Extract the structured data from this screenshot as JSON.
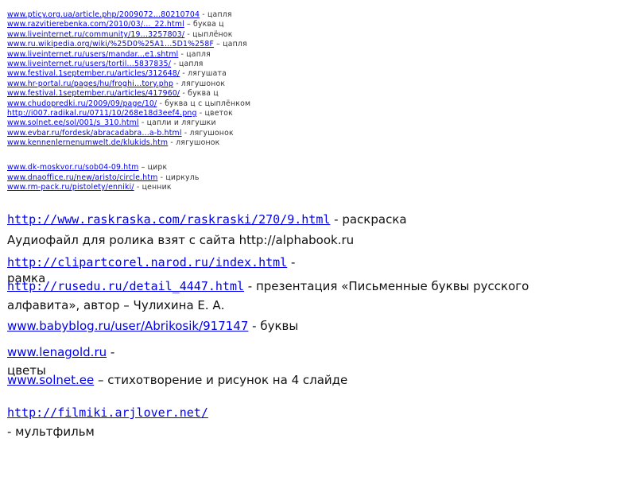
{
  "small_links_group1": [
    {
      "url": "www.pticy.org.ua/article.php/2009072...80210704",
      "desc": " - цапля"
    },
    {
      "url": "www.razvitierebenka.com/2010/03/..._22.html",
      "desc": " – буква ц"
    },
    {
      "url": "www.liveinternet.ru/community/19...3257803/",
      "desc": " - цыплёнок"
    },
    {
      "url": "www.ru.wikipedia.org/wiki/%25D0%25A1...5D1%258F",
      "desc": " – цапля"
    },
    {
      "url": "www.liveinternet.ru/users/mandar...e1.shtml",
      "desc": " - цапля"
    },
    {
      "url": "www.liveinternet.ru/users/tortil...5837835/",
      "desc": " - цапля"
    },
    {
      "url": "www.festival.1september.ru/articles/312648/",
      "desc": " - лягушата"
    },
    {
      "url": "www.hr-portal.ru/pages/hu/froghi...tory.php",
      "desc": " - лягушонок"
    },
    {
      "url": "www.festival.1september.ru/articles/417960/",
      "desc": " - буква ц"
    },
    {
      "url": "www.chudopredki.ru/2009/09/page/10/",
      "desc": " - буква ц с цыплёнком"
    },
    {
      "url": "http://i007.radikal.ru/0711/10/268e18d3eef4.png",
      "desc": " - цветок"
    },
    {
      "url": "www.solnet.ee/sol/001/s_310.html",
      "desc": " - цапли и лягушки"
    },
    {
      "url": "www.evbar.ru/fordesk/abracadabra...a-b.html",
      "desc": " - лягушонок"
    },
    {
      "url": "www.kennenlernenumwelt.de/klukids.htm",
      "desc": " - лягушонок"
    }
  ],
  "small_links_group2": [
    {
      "url": "www.dk-moskvor.ru/sob04-09.htm",
      "desc": " – цирк"
    },
    {
      "url": "www.dnaoffice.ru/new/aristo/circle.htm",
      "desc": " - циркуль"
    },
    {
      "url": "www.rm-pack.ru/pistolety/enniki/",
      "desc": " - ценник"
    }
  ],
  "big": {
    "raskraska_url": "http://www.raskraska.com/raskraski/270/9.html",
    "raskraska_desc": " - раскраска",
    "audio_text": "Аудиофайл для ролика взят с сайта http://alphabook.ru",
    "clipart_url": "http://clipartcorel.narod.ru/index.html",
    "clipart_desc": " - рамка",
    "rusedu_url": "http://rusedu.ru/detail_4447.html",
    "rusedu_desc": " - презентация «Письменные буквы русского алфавита», автор – Чулихина Е. А.",
    "babyblog_url": "www.babyblog.ru/user/Abrikosik/917147",
    "babyblog_desc": " - буквы",
    "lenagold_url": "www.lenagold.ru",
    "lenagold_desc": " - цветы",
    "solnet_url": "www.solnet.ee",
    "solnet_desc": " – стихотворение и рисунок на 4 слайде",
    "filmiki_url": "http://filmiki.arjlover.net/",
    "filmiki_desc": " - мультфильм"
  }
}
